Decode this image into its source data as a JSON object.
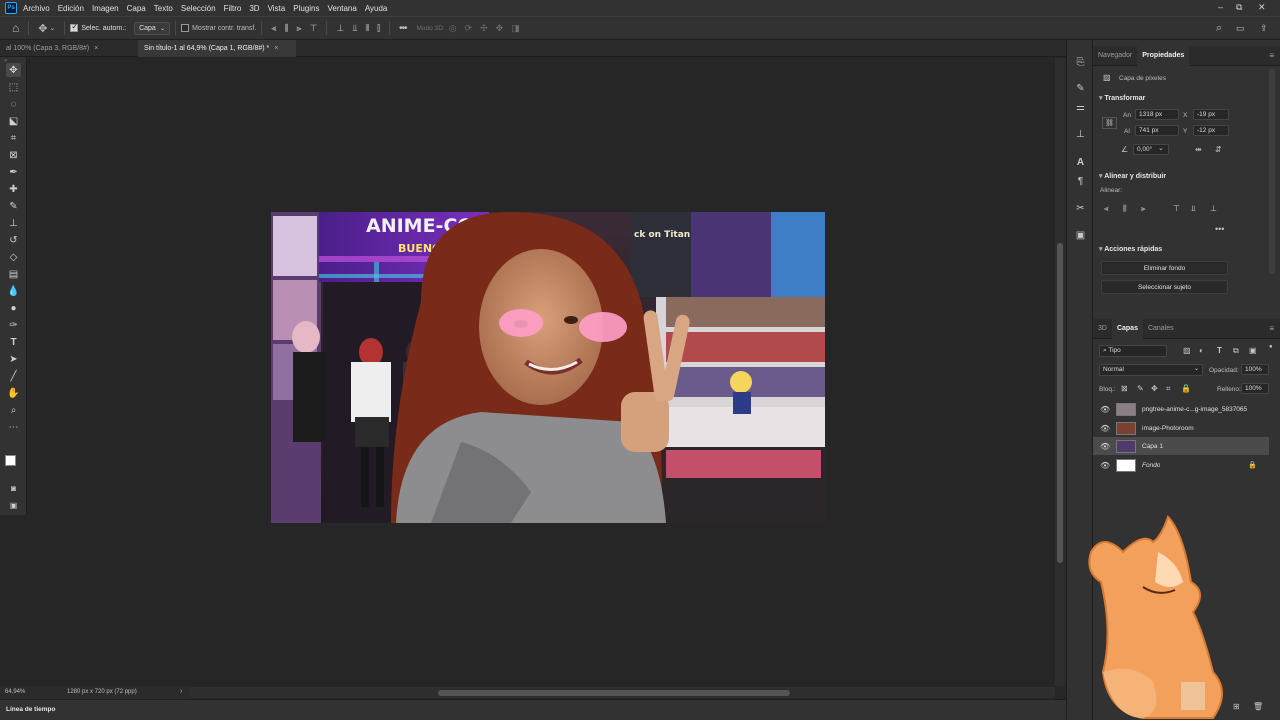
{
  "menubar": {
    "items": [
      "Archivo",
      "Edición",
      "Imagen",
      "Capa",
      "Texto",
      "Selección",
      "Filtro",
      "3D",
      "Vista",
      "Plugins",
      "Ventana",
      "Ayuda"
    ],
    "window_controls": {
      "minimize": "–",
      "restore": "⧉",
      "close": "✕"
    }
  },
  "options": {
    "auto_select_label": "Selec. autom.:",
    "auto_select_checked": true,
    "auto_select_target": "Capa",
    "show_transform_label": "Mostrar contr. transf.",
    "show_transform_checked": false,
    "more": "•••",
    "mode3d_label": "Modo 3D:"
  },
  "tabs": [
    {
      "title": "al 100% (Capa 3, RGB/8#)",
      "active": false
    },
    {
      "title": "Sin título-1 al 64,9% (Capa 1, RGB/8#) *",
      "active": true
    }
  ],
  "tools": [
    "move-tool",
    "marquee-tool",
    "lasso-tool",
    "object-select-tool",
    "crop-tool",
    "frame-tool",
    "eyedropper-tool",
    "healing-tool",
    "brush-tool",
    "stamp-tool",
    "history-brush-tool",
    "eraser-tool",
    "gradient-tool",
    "blur-tool",
    "dodge-tool",
    "pen-tool",
    "type-tool",
    "path-select-tool",
    "line-tool",
    "hand-tool",
    "zoom-tool",
    "more-tools"
  ],
  "canvas_image": {
    "banner_line1": "ANIME-CO",
    "banner_line2": "BUENOS AIRES",
    "poster_text": "ck on Titan"
  },
  "statusbar": {
    "zoom": "64,94%",
    "doc_size": "1280 px x 720 px (72 ppp)"
  },
  "timeline_label": "Línea de tiempo",
  "properties": {
    "tab_navigator": "Navegador",
    "tab_properties": "Propiedades",
    "layer_kind": "Capa de píxeles",
    "transform_title": "Transformar",
    "w_label": "An",
    "w_value": "1318 px",
    "h_label": "Al",
    "h_value": "741 px",
    "x_label": "X",
    "x_value": "-19 px",
    "y_label": "Y",
    "y_value": "-12 px",
    "angle_value": "0,00°",
    "align_title": "Alinear y distribuir",
    "align_label": "Alinear:",
    "align_more": "•••",
    "quick_actions_title": "Acciones rápidas",
    "btn_remove_bg": "Eliminar fondo",
    "btn_select_subject": "Seleccionar sujeto"
  },
  "layers": {
    "tab_3d": "3D",
    "tab_layers": "Capas",
    "tab_channels": "Canales",
    "filter_kind": "Tipo",
    "blend_mode": "Normal",
    "opacity_label": "Opacidad:",
    "opacity_value": "100%",
    "lock_label": "Bloq.:",
    "fill_label": "Relleno:",
    "fill_value": "100%",
    "items": [
      {
        "name": "pngtree-anime-c...g-image_5837065",
        "selected": false,
        "italic": false
      },
      {
        "name": "image-Photoroom",
        "selected": false,
        "italic": false
      },
      {
        "name": "Capa 1",
        "selected": true,
        "italic": false
      },
      {
        "name": "Fondo",
        "selected": false,
        "italic": true
      }
    ]
  },
  "colors": {
    "accent": "#31a8ff",
    "panel_bg": "#323232",
    "canvas_bg": "#262626"
  }
}
